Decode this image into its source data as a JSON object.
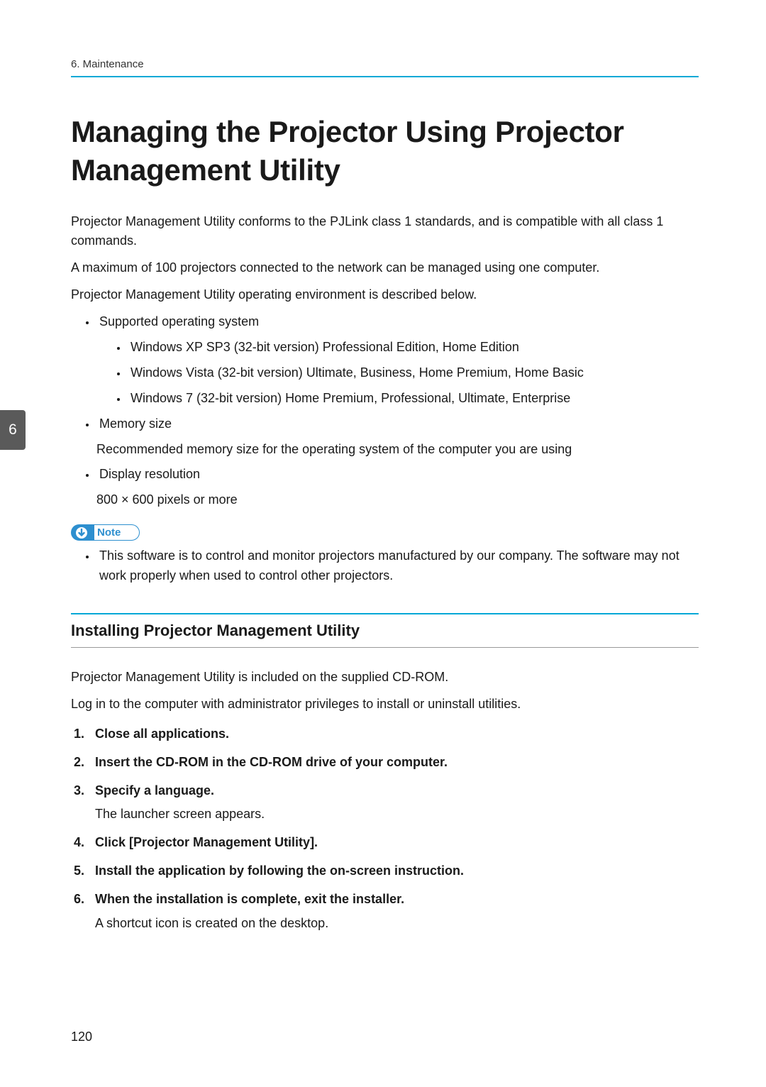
{
  "header": {
    "running": "6. Maintenance",
    "chapter_tab": "6"
  },
  "title": "Managing the Projector Using Projector Management Utility",
  "intro": {
    "p1": "Projector Management Utility conforms to the PJLink class 1 standards, and is compatible with all class 1 commands.",
    "p2": "A maximum of 100 projectors connected to the network can be managed using one computer.",
    "p3": "Projector Management Utility operating environment is described below."
  },
  "env": {
    "item1": {
      "label": "Supported operating system",
      "sub": {
        "a": "Windows XP SP3 (32-bit version) Professional Edition, Home Edition",
        "b": "Windows Vista (32-bit version) Ultimate, Business, Home Premium, Home Basic",
        "c": "Windows 7 (32-bit version) Home Premium, Professional, Ultimate, Enterprise"
      }
    },
    "item2": {
      "label": "Memory size",
      "desc": "Recommended memory size for the operating system of the computer you are using"
    },
    "item3": {
      "label": "Display resolution",
      "desc": "800 × 600 pixels or more"
    }
  },
  "note": {
    "label": "Note",
    "items": {
      "a": "This software is to control and monitor projectors manufactured by our company. The software may not work properly when used to control other projectors."
    }
  },
  "section": {
    "title": "Installing Projector Management Utility",
    "p1": "Projector Management Utility is included on the supplied CD-ROM.",
    "p2": "Log in to the computer with administrator privileges to install or uninstall utilities.",
    "steps": {
      "s1": "Close all applications.",
      "s2": "Insert the CD-ROM in the CD-ROM drive of your computer.",
      "s3": "Specify a language.",
      "s3_sub": "The launcher screen appears.",
      "s4": "Click [Projector Management Utility].",
      "s5": "Install the application by following the on-screen instruction.",
      "s6": "When the installation is complete, exit the installer.",
      "s6_sub": "A shortcut icon is created on the desktop."
    }
  },
  "page_number": "120"
}
